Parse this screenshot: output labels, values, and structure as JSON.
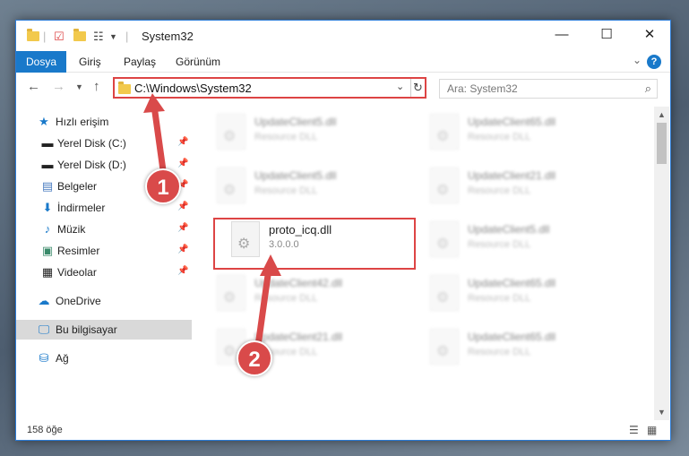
{
  "window": {
    "title": "System32",
    "controls": {
      "minimize": "—",
      "maximize": "☐",
      "close": "✕"
    }
  },
  "ribbon": {
    "tabs": [
      "Dosya",
      "Giriş",
      "Paylaş",
      "Görünüm"
    ]
  },
  "nav": {
    "address": "C:\\Windows\\System32",
    "search_placeholder": "Ara: System32"
  },
  "sidebar": {
    "items": [
      {
        "label": "Hızlı erişim",
        "icon": "star-icon"
      },
      {
        "label": "Yerel Disk (C:)",
        "icon": "drive-icon"
      },
      {
        "label": "Yerel Disk (D:)",
        "icon": "drive-icon"
      },
      {
        "label": "Belgeler",
        "icon": "documents-icon"
      },
      {
        "label": "İndirmeler",
        "icon": "download-icon"
      },
      {
        "label": "Müzik",
        "icon": "music-icon"
      },
      {
        "label": "Resimler",
        "icon": "pictures-icon"
      },
      {
        "label": "Videolar",
        "icon": "video-icon"
      },
      {
        "label": "OneDrive",
        "icon": "cloud-icon"
      },
      {
        "label": "Bu bilgisayar",
        "icon": "computer-icon"
      },
      {
        "label": "Ağ",
        "icon": "network-icon"
      }
    ]
  },
  "files": [
    {
      "name": "UpdateClient5.dll",
      "desc": "Resource DLL"
    },
    {
      "name": "UpdateClient65.dll",
      "desc": "Resource DLL"
    },
    {
      "name": "UpdateClient5.dll",
      "desc": "Resource DLL"
    },
    {
      "name": "UpdateClient21.dll",
      "desc": "Resource DLL"
    },
    {
      "name": "proto_icq.dll",
      "desc": "3.0.0.0"
    },
    {
      "name": "UpdateClient5.dll",
      "desc": "Resource DLL"
    },
    {
      "name": "UpdateClient42.dll",
      "desc": "Resource DLL"
    },
    {
      "name": "UpdateClient65.dll",
      "desc": "Resource DLL"
    },
    {
      "name": "UpdateClient21.dll",
      "desc": "Resource DLL"
    },
    {
      "name": "UpdateClient65.dll",
      "desc": "Resource DLL"
    }
  ],
  "status": {
    "count": "158 öğe"
  },
  "annotations": {
    "marker1": "1",
    "marker2": "2"
  },
  "colors": {
    "accent": "#1979ca",
    "highlight": "#d44444"
  }
}
